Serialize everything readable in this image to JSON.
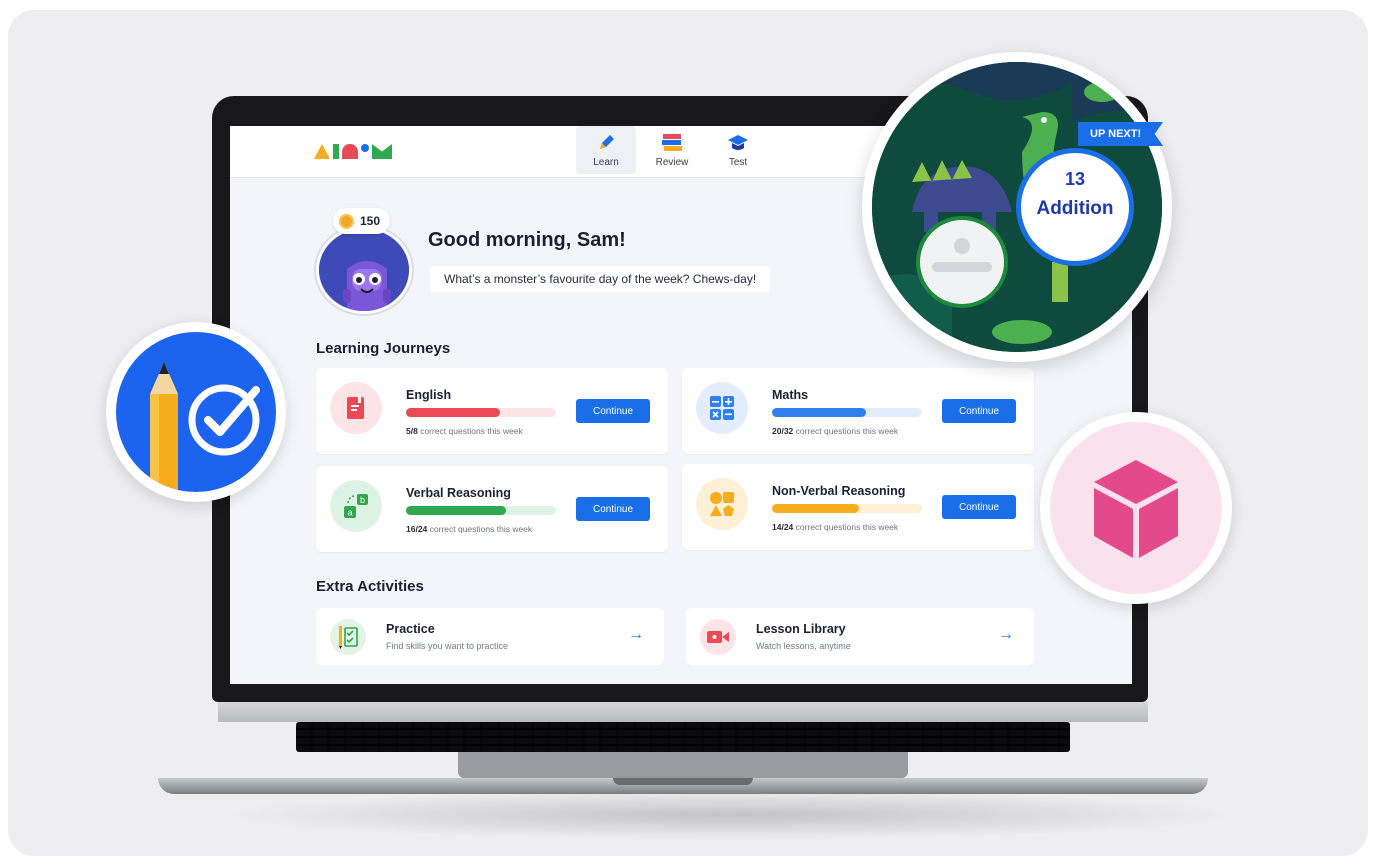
{
  "app": {
    "logo_text": "atom",
    "nav": [
      {
        "label": "Learn",
        "icon": "pencil-icon"
      },
      {
        "label": "Review",
        "icon": "books-icon"
      },
      {
        "label": "Test",
        "icon": "graduation-cap-icon"
      }
    ]
  },
  "profile": {
    "coins": "150",
    "greeting": "Good morning, Sam!",
    "joke": "What’s a monster’s favourite day of the week? Chews-day!"
  },
  "learning_journeys": {
    "title": "Learning Journeys",
    "items": [
      {
        "name": "English",
        "score": "5/8",
        "stat": " correct questions this week",
        "progress": 0.625,
        "color": "#ea4a55",
        "track": "#fde4e6",
        "icon_bg": "#fde4e6",
        "icon": "book-icon",
        "button": "Continue"
      },
      {
        "name": "Maths",
        "score": "20/32",
        "stat": " correct questions this week",
        "progress": 0.625,
        "color": "#2f80ed",
        "track": "#e3edfc",
        "icon_bg": "#e3edfc",
        "icon": "calculator-icon",
        "button": "Continue"
      },
      {
        "name": "Verbal Reasoning",
        "score": "16/24",
        "stat": " correct questions this week",
        "progress": 0.667,
        "color": "#2fa84f",
        "track": "#dff3e5",
        "icon_bg": "#dff3e5",
        "icon": "letters-ab-icon",
        "button": "Continue"
      },
      {
        "name": "Non-Verbal Reasoning",
        "score": "14/24",
        "stat": " correct questions this week",
        "progress": 0.583,
        "color": "#f5ad1e",
        "track": "#fdf0d6",
        "icon_bg": "#fdf0d6",
        "icon": "shapes-icon",
        "button": "Continue"
      }
    ]
  },
  "extra_activities": {
    "title": "Extra Activities",
    "items": [
      {
        "name": "Practice",
        "sub": "Find skills you want to practice",
        "icon": "checklist-icon",
        "arrow": "→"
      },
      {
        "name": "Lesson Library",
        "sub": "Watch lessons, anytime",
        "icon": "video-camera-icon",
        "arrow": "→"
      }
    ]
  },
  "up_next": {
    "banner": "UP NEXT!",
    "lesson_number": "13",
    "lesson_name": "Addition"
  },
  "colors": {
    "primary": "#1a6fe8",
    "background": "#f4f5fa"
  }
}
